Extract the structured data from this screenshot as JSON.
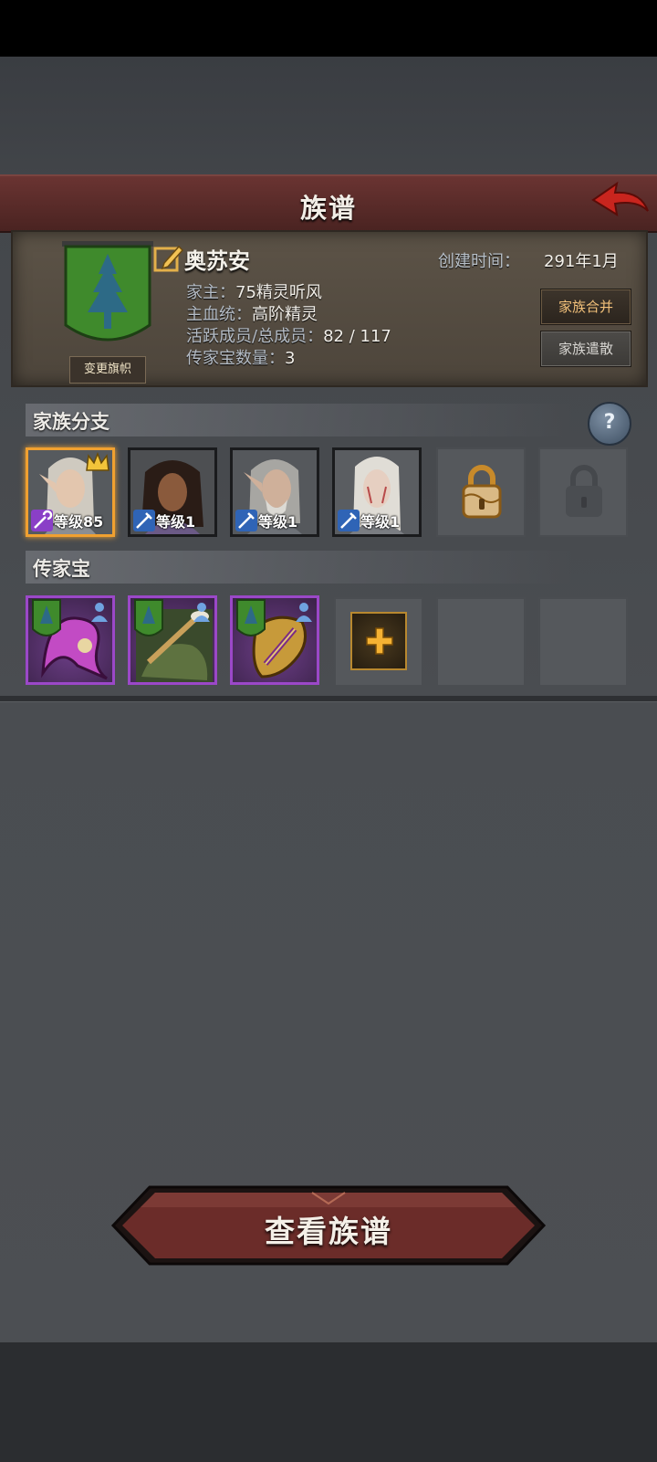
{
  "header": {
    "title": "族谱"
  },
  "family": {
    "name": "奥苏安",
    "created_label": "创建时间：",
    "created_value": "291年1月",
    "head_label": "家主：",
    "head_value": "75精灵听风",
    "bloodline_label": "主血统：",
    "bloodline_value": "高阶精灵",
    "members_label": "活跃成员/总成员：",
    "members_value": "82 / 117",
    "heirloom_label": "传家宝数量：",
    "heirloom_value": "3",
    "change_flag_label": "变更旗帜",
    "merge_label": "家族合并",
    "dissolve_label": "家族遣散"
  },
  "branches": {
    "title": "家族分支",
    "help_label": "?",
    "members": [
      {
        "level": "等级85",
        "leader": true,
        "class": "staff"
      },
      {
        "level": "等级1",
        "leader": false,
        "class": "sword"
      },
      {
        "level": "等级1",
        "leader": false,
        "class": "sword"
      },
      {
        "level": "等级1",
        "leader": false,
        "class": "sword"
      }
    ],
    "locked_slots": [
      "unlockable",
      "locked"
    ]
  },
  "heirlooms": {
    "title": "传家宝",
    "items": [
      "hood-helm",
      "spear",
      "ornate-amulet"
    ]
  },
  "actions": {
    "view_label": "查看族谱"
  },
  "colors": {
    "title_bar": "#5a2b29",
    "leader_border": "#f0a030",
    "heirloom_border": "#9b48c8",
    "accent_gold": "#f3c17a"
  }
}
